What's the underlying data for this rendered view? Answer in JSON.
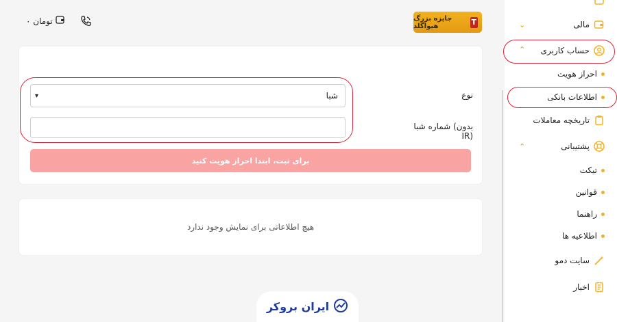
{
  "header": {
    "wallet_amount": "۰ تومان",
    "prize_label": "جایزه بزرگ هیواگلد",
    "prize_badge": "T"
  },
  "form": {
    "type_label": "نوع",
    "type_selected": "شبا",
    "sheba_label": "شماره شبا (بدون IR)",
    "sheba_value": "",
    "submit_label": "برای ثبت، ابتدا احراز هویت کنید"
  },
  "empty_state": {
    "message": "هیچ اطلاعاتی برای نمایش وجود ندارد"
  },
  "footer": {
    "logo_text": "ایران بروکر"
  },
  "sidebar": {
    "items": [
      {
        "label": "مالی",
        "icon": "wallet-icon"
      },
      {
        "label": "حساب کاربری",
        "icon": "user-circle-icon"
      },
      {
        "label": "احراز هویت",
        "icon": "dot"
      },
      {
        "label": "اطلاعات بانکی",
        "icon": "dot"
      },
      {
        "label": "تاریخچه معاملات",
        "icon": "clipboard-icon"
      },
      {
        "label": "پشتیبانی",
        "icon": "lifebuoy-icon"
      },
      {
        "label": "تیکت",
        "icon": "dot"
      },
      {
        "label": "قوانین",
        "icon": "dot"
      },
      {
        "label": "راهنما",
        "icon": "dot"
      },
      {
        "label": "اطلاعیه ها",
        "icon": "dot"
      },
      {
        "label": "سایت دمو",
        "icon": "wand-icon"
      },
      {
        "label": "اخبار",
        "icon": "news-icon"
      }
    ]
  },
  "colors": {
    "accent": "#f2b21f",
    "submit_bg": "#f9a3a3",
    "highlight": "#d8243b",
    "logo": "#1d3b9e"
  }
}
